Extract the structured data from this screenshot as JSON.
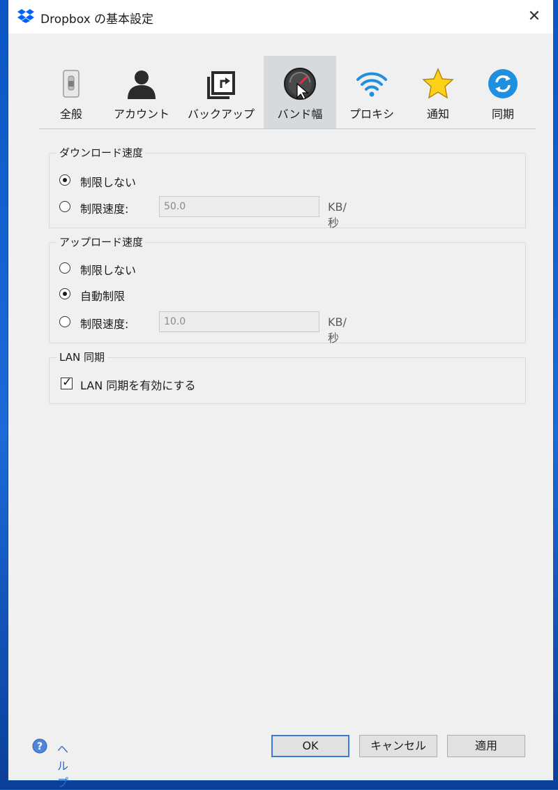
{
  "window": {
    "title": "Dropbox の基本設定",
    "close_glyph": "✕"
  },
  "tabs": [
    {
      "label": "全般",
      "icon": "switch-icon",
      "active": false
    },
    {
      "label": "アカウント",
      "icon": "person-icon",
      "active": false
    },
    {
      "label": "バックアップ",
      "icon": "backup-icon",
      "active": false
    },
    {
      "label": "バンド幅",
      "icon": "speedometer-icon",
      "active": true
    },
    {
      "label": "プロキシ",
      "icon": "wifi-icon",
      "active": false
    },
    {
      "label": "通知",
      "icon": "star-icon",
      "active": false
    },
    {
      "label": "同期",
      "icon": "sync-icon",
      "active": false
    }
  ],
  "download": {
    "legend": "ダウンロード速度",
    "option_unlimited": "制限しない",
    "option_limit": "制限速度:",
    "limit_value": "50.0",
    "unit": "KB/秒",
    "selected": "unlimited"
  },
  "upload": {
    "legend": "アップロード速度",
    "option_unlimited": "制限しない",
    "option_auto": "自動制限",
    "option_limit": "制限速度:",
    "limit_value": "10.0",
    "unit": "KB/秒",
    "selected": "auto"
  },
  "lan": {
    "legend": "LAN 同期",
    "checkbox_label": "LAN 同期を有効にする",
    "checked": true,
    "check_glyph": "✓"
  },
  "footer": {
    "help_label": "ヘルプ",
    "ok_label": "OK",
    "cancel_label": "キャンセル",
    "apply_label": "適用"
  },
  "colors": {
    "accent": "#3a7bd5",
    "dropbox_blue": "#0061fe",
    "active_tab_bg": "#d6dadd",
    "help_link": "#2a6ebb"
  }
}
